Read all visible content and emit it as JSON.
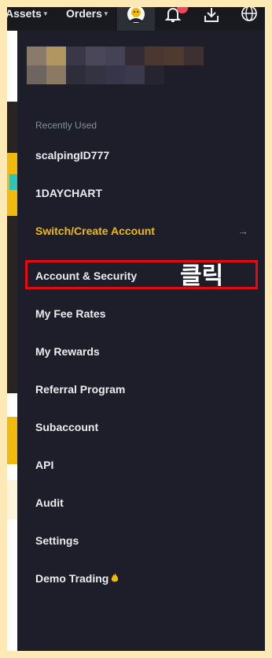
{
  "topbar": {
    "assets_label": "Assets",
    "orders_label": "Orders",
    "icons": [
      "avatar-icon",
      "bell-icon",
      "download-icon",
      "globe-icon"
    ]
  },
  "account": {
    "name_blurred": true
  },
  "menu": {
    "section_label": "Recently Used",
    "recent": [
      "scalpingID777",
      "1DAYCHART"
    ],
    "switch_label": "Switch/Create Account",
    "items": [
      "Account & Security",
      "My Fee Rates",
      "My Rewards",
      "Referral Program",
      "Subaccount",
      "API",
      "Audit",
      "Settings",
      "Demo Trading"
    ]
  },
  "annotation": {
    "callout": "클릭",
    "highlight_color": "#e50914"
  },
  "colors": {
    "accent": "#f0b90b",
    "panel_bg": "#1e1e2a",
    "frame_border": "#fde9b6"
  }
}
